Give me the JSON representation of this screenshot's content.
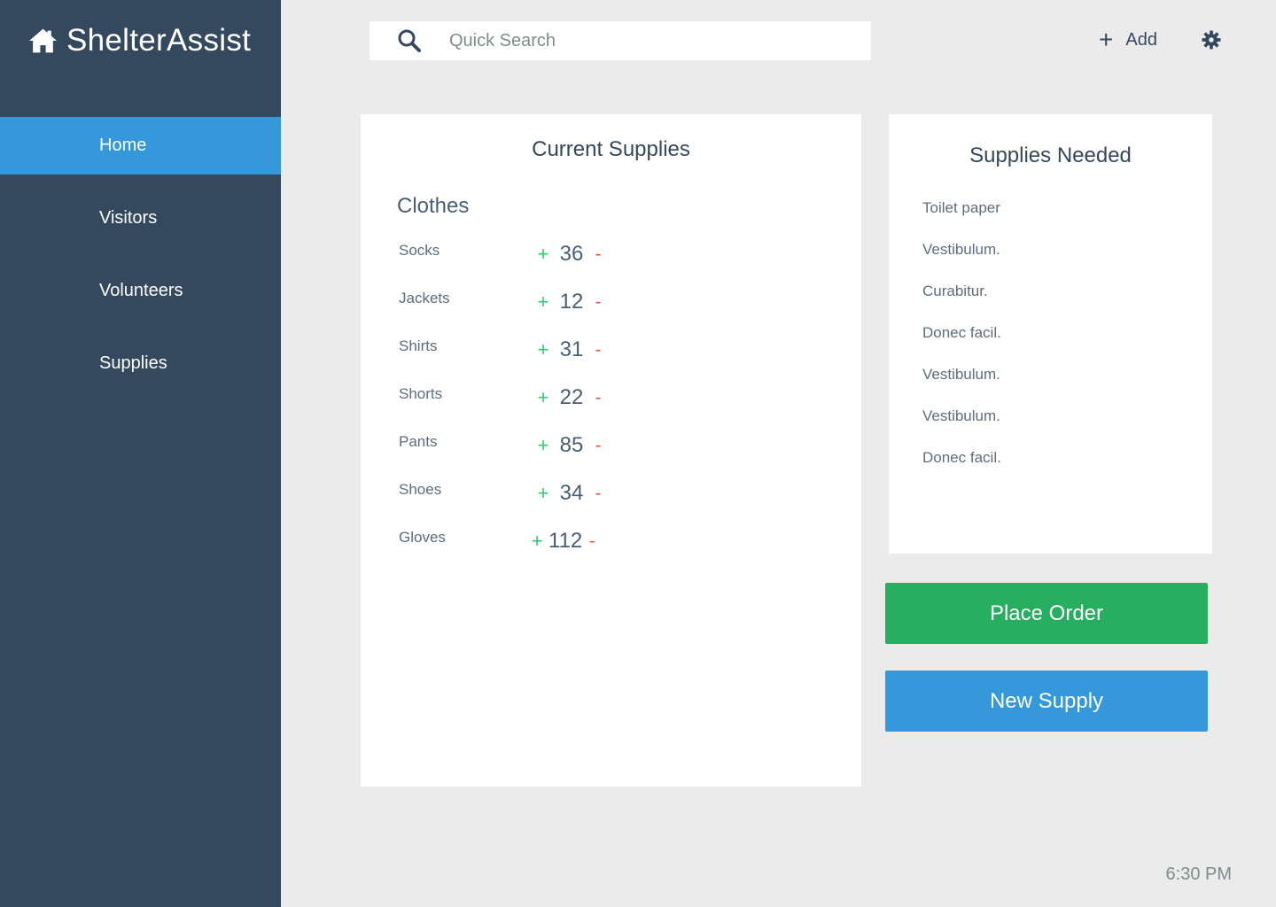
{
  "app": {
    "name": "ShelterAssist"
  },
  "nav": {
    "items": [
      {
        "label": "Home",
        "active": true
      },
      {
        "label": "Visitors",
        "active": false
      },
      {
        "label": "Volunteers",
        "active": false
      },
      {
        "label": "Supplies",
        "active": false
      }
    ]
  },
  "search": {
    "placeholder": "Quick Search",
    "value": ""
  },
  "toolbar": {
    "add_label": "Add",
    "add_icon": "plus-icon",
    "settings_icon": "gear-icon"
  },
  "current_supplies": {
    "title": "Current Supplies",
    "category": "Clothes",
    "items": [
      {
        "name": "Socks",
        "qty": "36"
      },
      {
        "name": "Jackets",
        "qty": "12"
      },
      {
        "name": "Shirts",
        "qty": "31"
      },
      {
        "name": "Shorts",
        "qty": "22"
      },
      {
        "name": "Pants",
        "qty": "85"
      },
      {
        "name": "Shoes",
        "qty": "34"
      },
      {
        "name": "Gloves",
        "qty": "112"
      }
    ],
    "increment_symbol": "+",
    "decrement_symbol": "-"
  },
  "supplies_needed": {
    "title": "Supplies Needed",
    "items": [
      "Toilet paper",
      "Vestibulum.",
      "Curabitur.",
      "Donec facil.",
      "Vestibulum.",
      "Vestibulum.",
      "Donec facil."
    ]
  },
  "actions": {
    "place_order": "Place Order",
    "new_supply": "New Supply"
  },
  "status": {
    "time": "6:30 PM"
  },
  "colors": {
    "sidebar": "#34495e",
    "active_nav": "#3498db",
    "place_order": "#27ae60",
    "new_supply": "#3498db",
    "increment": "#2ecc71",
    "decrement": "#e74c3c"
  }
}
